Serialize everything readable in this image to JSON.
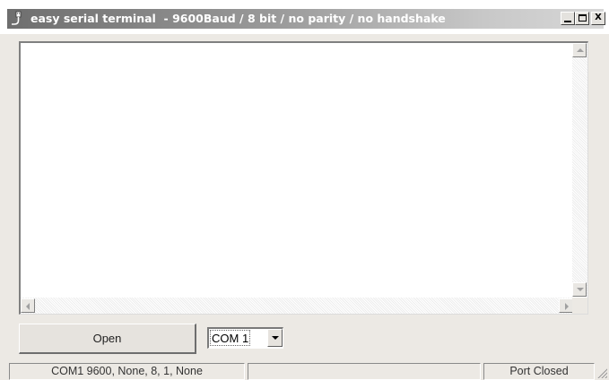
{
  "window": {
    "title": "easy serial terminal  - 9600Baud / 8 bit / no parity / no handshake",
    "minimize_icon": "minimize-icon",
    "maximize_icon": "maximize-icon",
    "close_label": "X",
    "app_icon": "serial-port-icon"
  },
  "terminal": {
    "content": ""
  },
  "controls": {
    "open_label": "Open",
    "port_selected": "COM 1"
  },
  "statusbar": {
    "settings": "COM1 9600, None, 8, 1, None",
    "middle": "",
    "port_state": "Port Closed"
  },
  "colors": {
    "title_gradient_start": "#6e6e6e",
    "title_gradient_end": "#d7d7d7",
    "face": "#ece9e4"
  }
}
